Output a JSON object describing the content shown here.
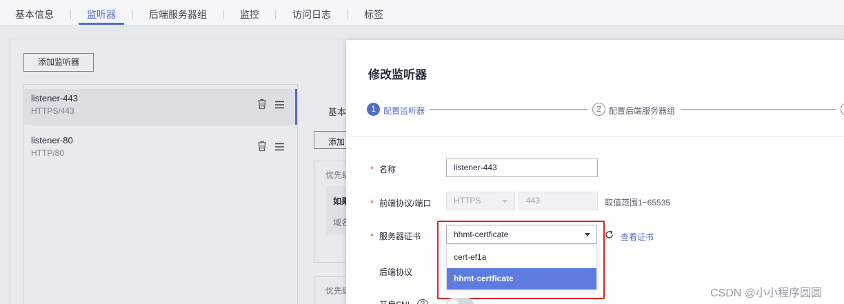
{
  "tabs": [
    {
      "label": "基本信息"
    },
    {
      "label": "监听器"
    },
    {
      "label": "后端服务器组"
    },
    {
      "label": "监控"
    },
    {
      "label": "访问日志"
    },
    {
      "label": "标签"
    }
  ],
  "background": {
    "add_listener_label": "添加监听器",
    "listeners": [
      {
        "name": "listener-443",
        "protocol": "HTTPS/443"
      },
      {
        "name": "listener-80",
        "protocol": "HTTP/80"
      }
    ],
    "peek": {
      "tab_label": "基本",
      "add_label": "添加",
      "priority_1": "优先级",
      "rule_title": "如果",
      "rule_sub": "域名",
      "priority_2": "优先级"
    }
  },
  "drawer": {
    "title": "修改监听器",
    "steps": [
      {
        "num": "1",
        "label": "配置监听器"
      },
      {
        "num": "2",
        "label": "配置后端服务器组"
      }
    ],
    "form": {
      "required_mark": "*",
      "name_label": "名称",
      "name_value": "listener-443",
      "frontend_label": "前端协议/端口",
      "protocol_value": "HTTPS",
      "port_value": "443",
      "port_hint": "取值范围1~65535",
      "cert_label": "服务器证书",
      "cert_selected": "hhmt-certficate",
      "cert_options": [
        "cert-ef1a",
        "hhmt-certficate"
      ],
      "view_cert_link": "查看证书",
      "backend_label": "后端协议",
      "sni_label": "开启SNI",
      "help_glyph": "?"
    }
  },
  "watermark": "CSDN @小小程序圆圆",
  "colors": {
    "accent": "#526ecc",
    "required": "#e54545",
    "highlight_box": "#e02020",
    "selected_option": "#5e7ce0"
  }
}
